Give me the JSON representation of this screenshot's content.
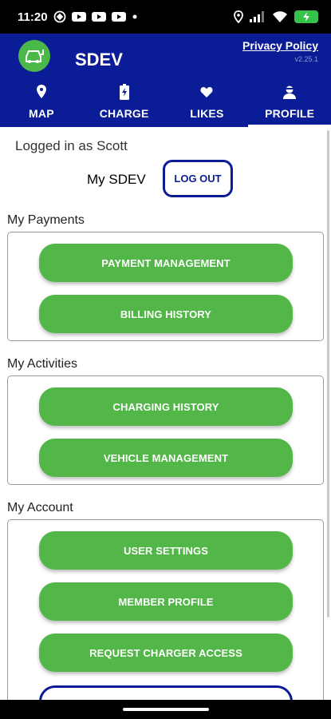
{
  "status_bar": {
    "time": "11:20",
    "icons": [
      "whatsapp-icon",
      "youtube-icon",
      "youtube-icon",
      "youtube-icon",
      "dot-icon",
      "location-icon",
      "signal-icon",
      "wifi-icon",
      "battery-charging-icon"
    ]
  },
  "header": {
    "app_name": "SDEV",
    "privacy_link": "Privacy Policy",
    "version": "v2.25.1",
    "logo_icon": "ev-car-icon",
    "brand_color": "#0a1c96",
    "accent_color": "#52b648"
  },
  "tabs": [
    {
      "label": "MAP",
      "icon": "map-pin-icon",
      "active": false
    },
    {
      "label": "CHARGE",
      "icon": "battery-icon",
      "active": false
    },
    {
      "label": "LIKES",
      "icon": "heart-icon",
      "active": false
    },
    {
      "label": "PROFILE",
      "icon": "person-icon",
      "active": true
    }
  ],
  "account": {
    "logged_in_text": "Logged in as Scott",
    "my_sdev_label": "My SDEV",
    "logout_label": "LOG OUT"
  },
  "sections": {
    "payments": {
      "title": "My Payments",
      "buttons": [
        "PAYMENT MANAGEMENT",
        "BILLING HISTORY"
      ]
    },
    "activities": {
      "title": "My Activities",
      "buttons": [
        "CHARGING HISTORY",
        "VEHICLE MANAGEMENT"
      ]
    },
    "account": {
      "title": "My Account",
      "buttons": [
        "USER SETTINGS",
        "MEMBER PROFILE",
        "REQUEST CHARGER ACCESS"
      ]
    }
  }
}
